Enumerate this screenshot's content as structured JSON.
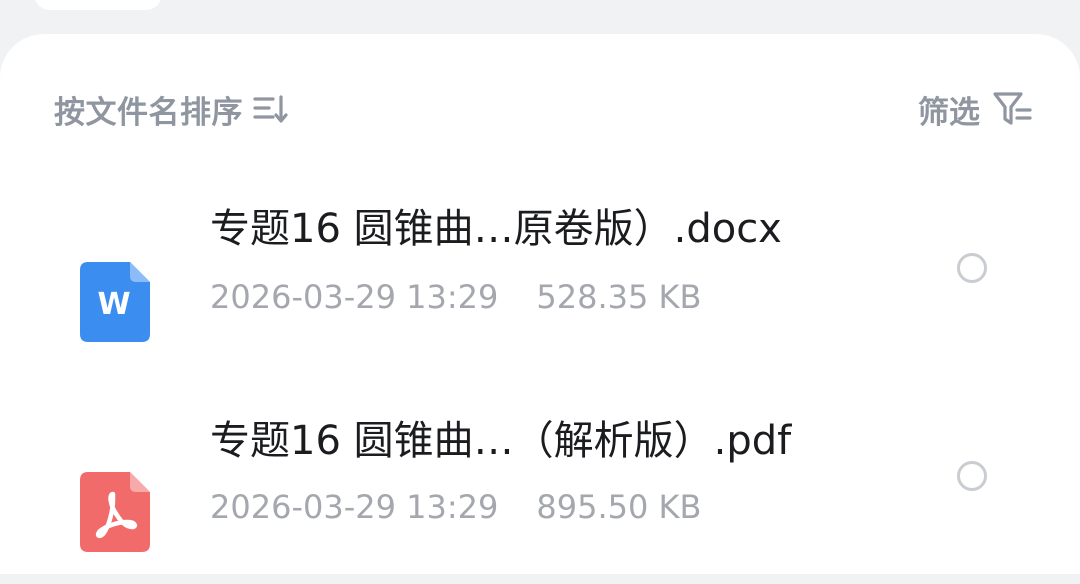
{
  "toolbar": {
    "sort_label": "按文件名排序",
    "sort_icon": "sort-order-icon",
    "filter_label": "筛选",
    "filter_icon": "filter-icon"
  },
  "files": [
    {
      "name": "专题16 圆锥曲…原卷版）.docx",
      "type": "docx",
      "icon": "word-document-icon",
      "icon_color": "#3b8ef0",
      "date": "2026-03-29 13:29",
      "size": "528.35 KB",
      "selected": false
    },
    {
      "name": "专题16 圆锥曲…（解析版）.pdf",
      "type": "pdf",
      "icon": "pdf-document-icon",
      "icon_color": "#f26b6b",
      "date": "2026-03-29 13:29",
      "size": "895.50 KB",
      "selected": false
    }
  ]
}
